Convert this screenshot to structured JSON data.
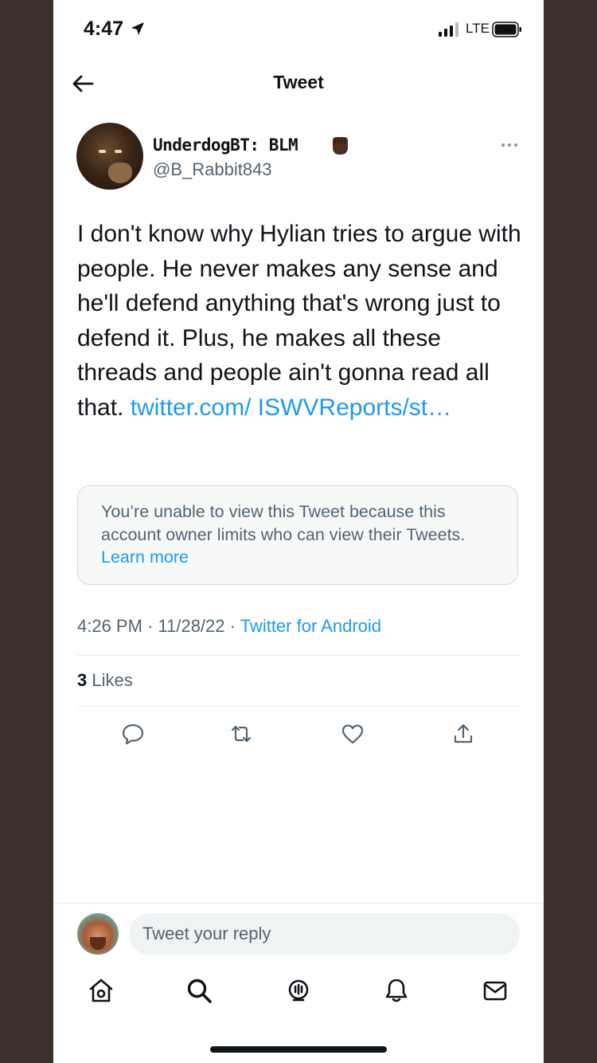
{
  "status_bar": {
    "time": "4:47",
    "carrier": "LTE"
  },
  "header": {
    "title": "Tweet",
    "back_icon": "arrow-left-icon"
  },
  "tweet": {
    "author": {
      "display_name": "UnderdogBT: BLM",
      "handle": "@B_Rabbit843"
    },
    "text": "I don't know why Hylian tries to argue with people. He never makes any sense and he'll defend anything that's wrong just to defend it. Plus, he makes all these threads and people ain't gonna read all that.",
    "link_text": "twitter.com/ ISWVReports/st…",
    "quoted_notice": {
      "text": "You’re unable to view this Tweet because this account owner limits who can view their Tweets.",
      "link": "Learn more"
    },
    "time": "4:26 PM",
    "date": "11/28/22",
    "source": "Twitter for Android",
    "likes_count": "3",
    "likes_label": "Likes"
  },
  "actions": [
    "reply-icon",
    "retweet-icon",
    "like-icon",
    "share-icon"
  ],
  "reply_input": {
    "placeholder": "Tweet your reply"
  },
  "bottom_nav": [
    "home-icon",
    "search-icon",
    "spaces-icon",
    "notifications-icon",
    "messages-icon"
  ],
  "colors": {
    "link": "#1d9bf0",
    "secondary_text": "#536471",
    "primary_text": "#0f1419",
    "background": "#ffffff"
  }
}
